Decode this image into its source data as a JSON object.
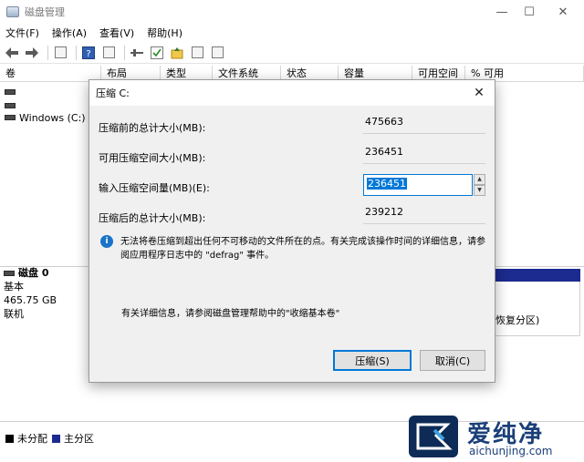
{
  "window": {
    "title": "磁盘管理",
    "controls": {
      "minimize": "—",
      "maximize": "☐",
      "close": "✕"
    }
  },
  "menu": [
    "文件(F)",
    "操作(A)",
    "查看(V)",
    "帮助(H)"
  ],
  "volume_table": {
    "columns": [
      "卷",
      "布局",
      "类型",
      "文件系统",
      "状态",
      "容量",
      "可用空间",
      "% 可用"
    ],
    "rows": [
      {
        "name": ""
      },
      {
        "name": ""
      },
      {
        "name": "Windows (C:)"
      }
    ]
  },
  "disk": {
    "name": "磁盘 0",
    "type": "基本",
    "size": "465.75 GB",
    "status": "联机",
    "partition_partial_label": "恢复分区)"
  },
  "legend": {
    "unallocated": {
      "label": "未分配",
      "color": "#000000"
    },
    "primary": {
      "label": "主分区",
      "color": "#1c2b8f"
    }
  },
  "dialog": {
    "title": "压缩 C:",
    "total_before_label": "压缩前的总计大小(MB):",
    "total_before_value": "475663",
    "available_label": "可用压缩空间大小(MB):",
    "available_value": "236451",
    "input_label": "输入压缩空间量(MB)(E):",
    "input_value": "236451",
    "total_after_label": "压缩后的总计大小(MB):",
    "total_after_value": "239212",
    "info_text": "无法将卷压缩到超出任何不可移动的文件所在的点。有关完成该操作时间的详细信息，请参阅应用程序日志中的 \"defrag\" 事件。",
    "help_text": "有关详细信息，请参阅磁盘管理帮助中的\"收缩基本卷\"",
    "shrink_button": "压缩(S)",
    "cancel_button": "取消(C)"
  },
  "watermark": {
    "brand": "爱纯净",
    "url": "aichunjing.com"
  }
}
